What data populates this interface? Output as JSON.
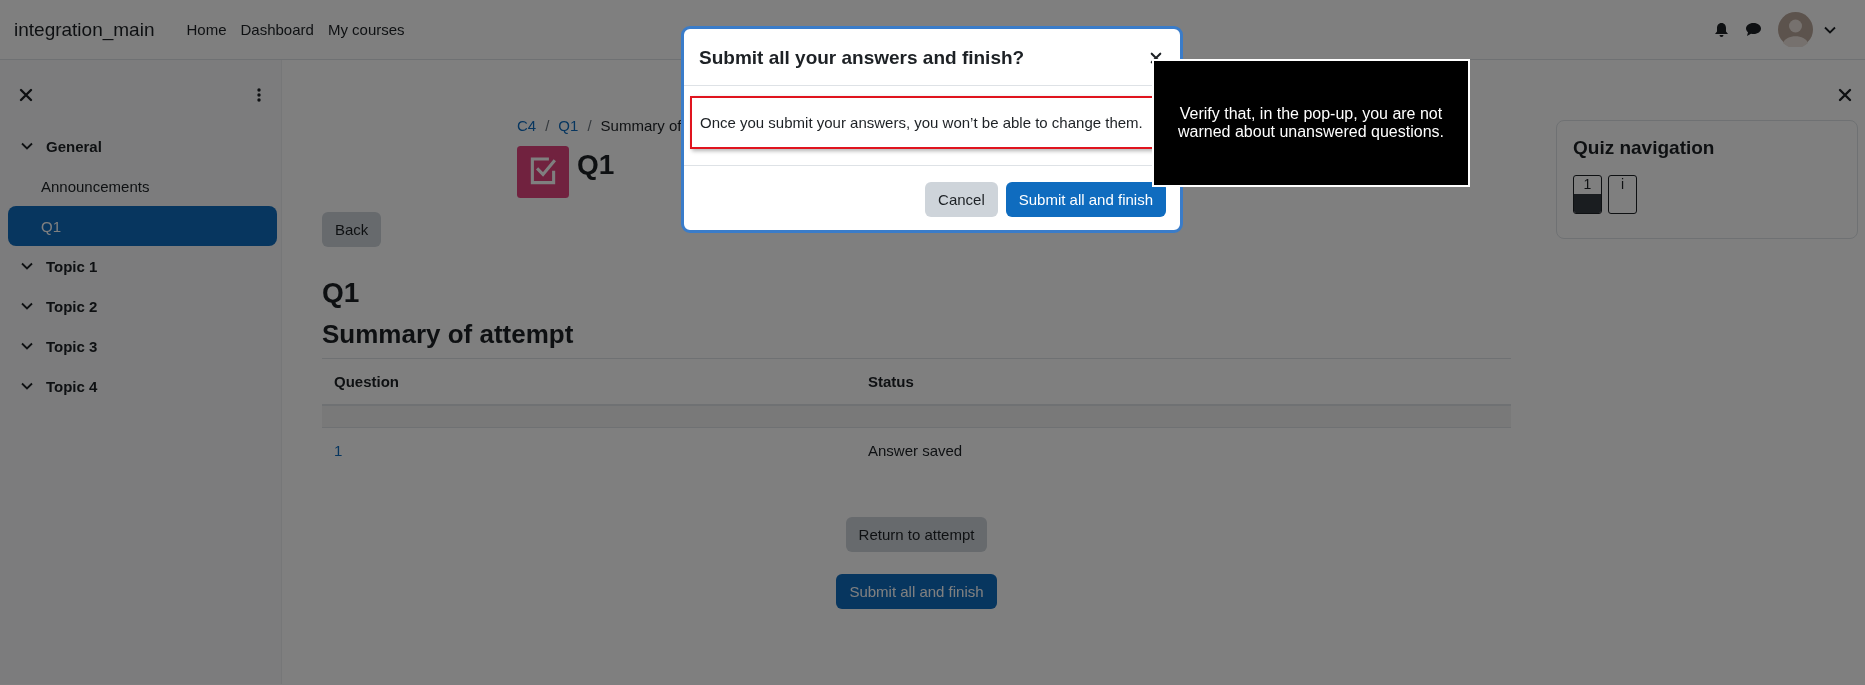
{
  "navbar": {
    "site_name": "integration_main",
    "links": [
      "Home",
      "Dashboard",
      "My courses"
    ]
  },
  "sidebar": {
    "sections": [
      {
        "label": "General",
        "expanded": true,
        "children": [
          {
            "label": "Announcements",
            "selected": false
          },
          {
            "label": "Q1",
            "selected": true
          }
        ]
      },
      {
        "label": "Topic 1",
        "expanded": true
      },
      {
        "label": "Topic 2",
        "expanded": true
      },
      {
        "label": "Topic 3",
        "expanded": true
      },
      {
        "label": "Topic 4",
        "expanded": true
      }
    ]
  },
  "breadcrumb_separator": "/",
  "breadcrumb": [
    {
      "label": "C4",
      "kind": "link"
    },
    {
      "label": "Q1",
      "kind": "link"
    },
    {
      "label": "Summary of",
      "kind": "current"
    }
  ],
  "page_header": {
    "title": "Q1"
  },
  "back_button": "Back",
  "heading": "Q1",
  "subheading": "Summary of attempt",
  "table": {
    "columns": [
      "Question",
      "Status"
    ],
    "rows": [
      {
        "question": "1",
        "status": "Answer saved"
      }
    ]
  },
  "actions": [
    {
      "label": "Return to attempt",
      "kind": "secondary"
    },
    {
      "label": "Submit all and finish",
      "kind": "primary"
    }
  ],
  "quiz_navigation": {
    "title": "Quiz navigation",
    "items": [
      {
        "label": "1",
        "answered": true
      },
      {
        "label": "i",
        "answered": false
      }
    ]
  },
  "modal": {
    "title": "Submit all your answers and finish?",
    "message": {
      "text": "Once you submit your answers, you won’t be able to change them.",
      "highlighted": true
    },
    "buttons": [
      {
        "label": "Cancel",
        "kind": "secondary"
      },
      {
        "label": "Submit all and finish",
        "kind": "primary"
      }
    ]
  },
  "annotation": {
    "text": "Verify that, in the pop-up, you are not warned about unanswered questions."
  }
}
